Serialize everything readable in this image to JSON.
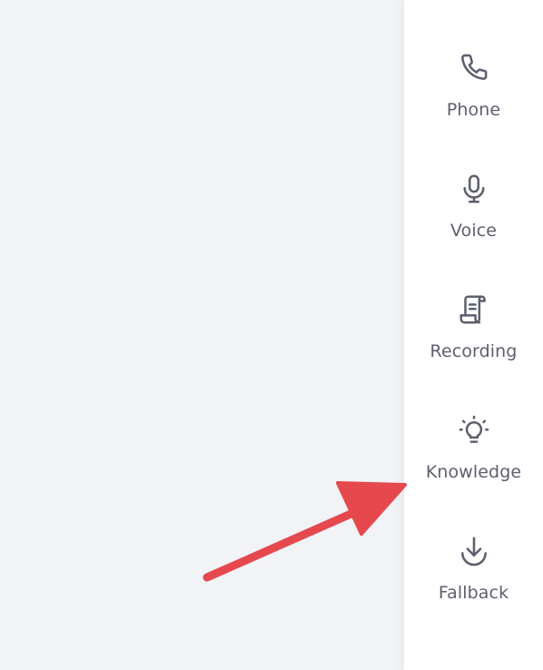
{
  "colors": {
    "background": "#f2f3f7",
    "sidebar_background": "#ffffff",
    "icon_color": "#5d5f6e",
    "label_color": "#5d5f6e",
    "annotation_arrow": "#e5484d"
  },
  "sidebar": {
    "items": [
      {
        "label": "Phone",
        "icon": "phone-icon"
      },
      {
        "label": "Voice",
        "icon": "microphone-icon"
      },
      {
        "label": "Recording",
        "icon": "scroll-icon"
      },
      {
        "label": "Knowledge",
        "icon": "lightbulb-icon"
      },
      {
        "label": "Fallback",
        "icon": "download-icon"
      }
    ]
  }
}
